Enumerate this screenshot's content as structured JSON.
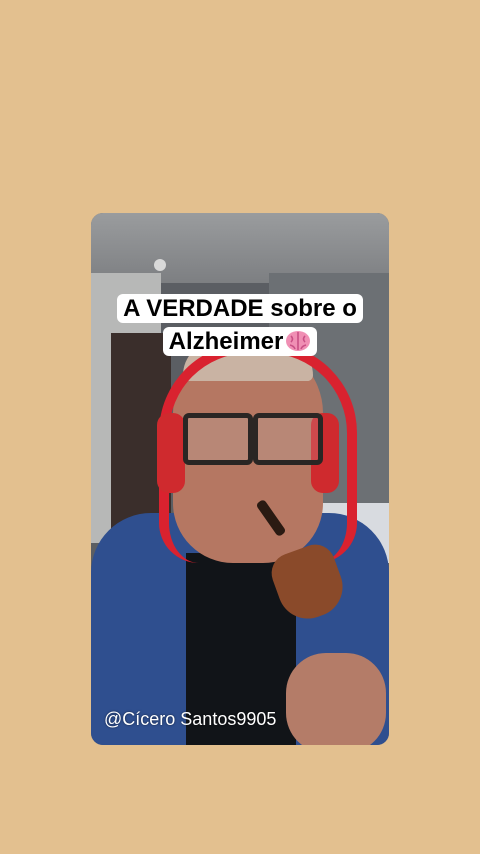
{
  "caption": {
    "line1": "A VERDADE sobre o",
    "line2": "Alzheimer",
    "emoji_icon": "brain-icon"
  },
  "watermark": {
    "handle": "@Cícero Santos9905"
  },
  "colors": {
    "background": "#e3c08f",
    "caption_bg": "#ffffff",
    "caption_text": "#000000"
  }
}
